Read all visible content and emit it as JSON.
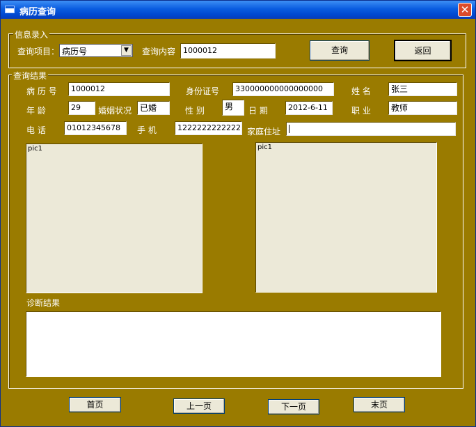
{
  "window": {
    "title": "病历查询",
    "close_label": "✕"
  },
  "input_group": {
    "legend": "信息录入",
    "query_item_label": "查询项目：",
    "query_item_value": "病历号",
    "query_content_label": "查询内容",
    "query_content_value": "1000012",
    "query_button": "查询",
    "back_button": "返回"
  },
  "result_group": {
    "legend": "查询结果",
    "record_no_label": "病 历 号",
    "record_no_value": "1000012",
    "id_no_label": "身份证号",
    "id_no_value": "330000000000000000",
    "name_label": "姓   名",
    "name_value": "张三",
    "age_label": "年    龄",
    "age_value": "29",
    "marital_label": "婚姻状况",
    "marital_value": "已婚",
    "gender_label": "性   别",
    "gender_value": "男",
    "date_label": "日   期",
    "date_value": "2012-6-11",
    "occupation_label": "职   业",
    "occupation_value": "教师",
    "phone_label": "电   话",
    "phone_value": "01012345678",
    "mobile_label": "手   机",
    "mobile_value": "1222222222222",
    "address_label": "家庭住址",
    "address_value": "",
    "pic1_label": "pic1",
    "pic2_label": "pic1",
    "diagnosis_label": "诊断结果",
    "diagnosis_value": ""
  },
  "nav": {
    "first": "首页",
    "prev": "上一页",
    "next": "下一页",
    "last": "末页"
  }
}
